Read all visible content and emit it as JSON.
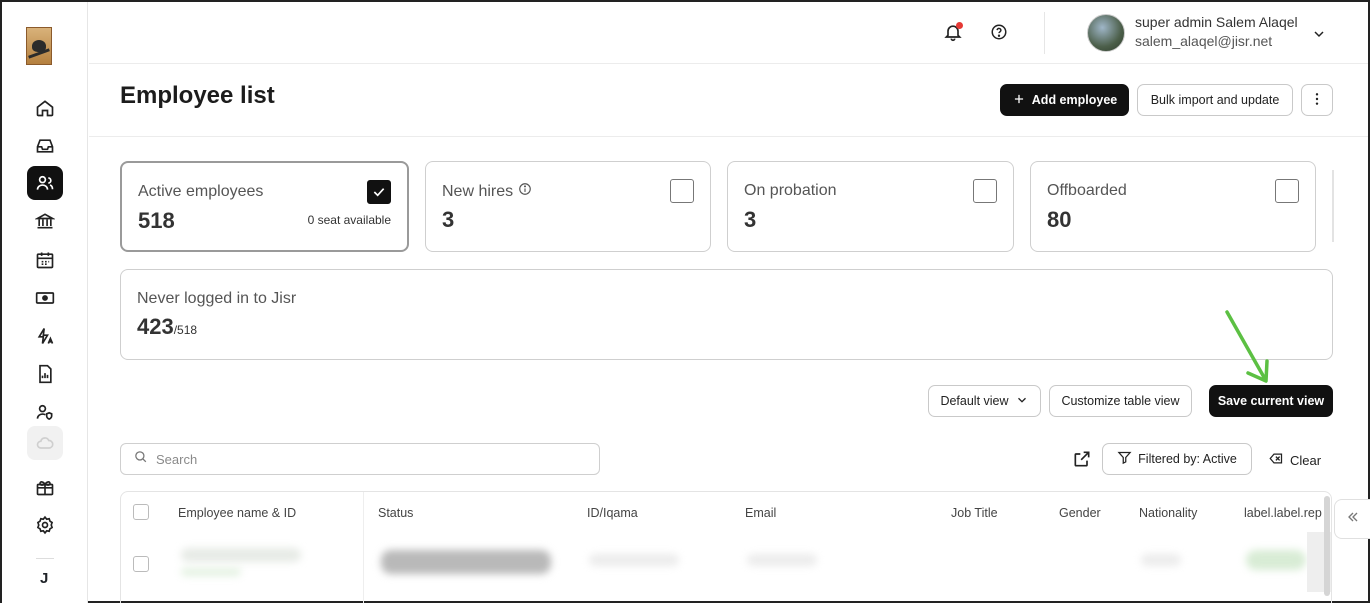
{
  "user": {
    "name": "super admin Salem Alaqel",
    "email": "salem_alaqel@jisr.net"
  },
  "page": {
    "title": "Employee list"
  },
  "header_actions": {
    "add_label": "Add employee",
    "bulk_label": "Bulk import and update"
  },
  "stat_cards": [
    {
      "label": "Active employees",
      "value": "518",
      "note": "0 seat available",
      "checked": true
    },
    {
      "label": "New hires",
      "value": "3",
      "checked": false
    },
    {
      "label": "On probation",
      "value": "3",
      "checked": false
    },
    {
      "label": "Offboarded",
      "value": "80",
      "checked": false
    }
  ],
  "login_card": {
    "label": "Never logged in to Jisr",
    "value": "423",
    "of": "/518"
  },
  "view_controls": {
    "default_view": "Default view",
    "customize": "Customize table view",
    "save": "Save current view"
  },
  "search": {
    "placeholder": "Search"
  },
  "filters": {
    "filtered_label": "Filtered by: Active",
    "clear_label": "Clear"
  },
  "table": {
    "columns": [
      "Employee name & ID",
      "Status",
      "ID/Iqama",
      "Email",
      "Job Title",
      "Gender",
      "Nationality",
      "label.label.rep"
    ]
  },
  "sidebar": {
    "footer_letter": "J"
  },
  "colors": {
    "primary": "#111111",
    "annotation_arrow": "#5cc043",
    "notification_dot": "#e53935"
  }
}
